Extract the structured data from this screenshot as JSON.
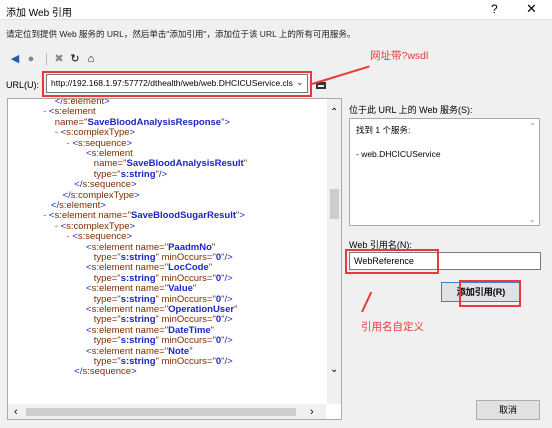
{
  "window": {
    "title": "添加 Web 引用",
    "help_label": "?",
    "close_label": "✕"
  },
  "instruction": "请定位到提供 Web 服务的 URL，然后单击\"添加引用\"，添加位于该 URL 上的所有可用服务。",
  "toolbar": {
    "back": "◀",
    "forward": "●",
    "stop": "✖",
    "refresh": "↻",
    "home": "⌂"
  },
  "url": {
    "label": "URL(U):",
    "value": "http://192.168.1.97:57772/dthealth/web/web.DHCICUService.cls",
    "dropdown": "⌄"
  },
  "annotations": {
    "url_note": "网址带?wsdl",
    "name_note": "引用名自定义"
  },
  "xml_lines": [
    {
      "indent": 12,
      "minus": "",
      "parts": [
        [
          "bracket",
          "</"
        ],
        [
          "tag",
          "s:element"
        ],
        [
          "bracket",
          ">"
        ]
      ]
    },
    {
      "indent": 9,
      "minus": "-",
      "parts": [
        [
          "bracket",
          "<"
        ],
        [
          "tag",
          "s:element"
        ]
      ]
    },
    {
      "indent": 12,
      "minus": "",
      "parts": [
        [
          "attr",
          "name=\""
        ],
        [
          "val",
          "SaveBloodAnalysisResponse"
        ],
        [
          "attr",
          "\""
        ],
        [
          "bracket",
          ">"
        ]
      ]
    },
    {
      "indent": 12,
      "minus": "-",
      "parts": [
        [
          "bracket",
          "<"
        ],
        [
          "tag",
          "s:complexType"
        ],
        [
          "bracket",
          ">"
        ]
      ]
    },
    {
      "indent": 15,
      "minus": "-",
      "parts": [
        [
          "bracket",
          "<"
        ],
        [
          "tag",
          "s:sequence"
        ],
        [
          "bracket",
          ">"
        ]
      ]
    },
    {
      "indent": 20,
      "minus": "",
      "parts": [
        [
          "bracket",
          "<"
        ],
        [
          "tag",
          "s:element"
        ]
      ]
    },
    {
      "indent": 22,
      "minus": "",
      "parts": [
        [
          "attr",
          "name=\""
        ],
        [
          "val",
          "SaveBloodAnalysisResult"
        ],
        [
          "attr",
          "\""
        ]
      ]
    },
    {
      "indent": 22,
      "minus": "",
      "parts": [
        [
          "attr",
          "type=\""
        ],
        [
          "val",
          "s:string"
        ],
        [
          "attr",
          "\""
        ],
        [
          "bracket",
          "/>"
        ]
      ]
    },
    {
      "indent": 17,
      "minus": "",
      "parts": [
        [
          "bracket",
          "</"
        ],
        [
          "tag",
          "s:sequence"
        ],
        [
          "bracket",
          ">"
        ]
      ]
    },
    {
      "indent": 14,
      "minus": "",
      "parts": [
        [
          "bracket",
          "</"
        ],
        [
          "tag",
          "s:complexType"
        ],
        [
          "bracket",
          ">"
        ]
      ]
    },
    {
      "indent": 11,
      "minus": "",
      "parts": [
        [
          "bracket",
          "</"
        ],
        [
          "tag",
          "s:element"
        ],
        [
          "bracket",
          ">"
        ]
      ]
    },
    {
      "indent": 9,
      "minus": "-",
      "parts": [
        [
          "bracket",
          "<"
        ],
        [
          "tag",
          "s:element "
        ],
        [
          "attr",
          "name=\""
        ],
        [
          "val",
          "SaveBloodSugarResult"
        ],
        [
          "attr",
          "\""
        ],
        [
          "bracket",
          ">"
        ]
      ]
    },
    {
      "indent": 12,
      "minus": "-",
      "parts": [
        [
          "bracket",
          "<"
        ],
        [
          "tag",
          "s:complexType"
        ],
        [
          "bracket",
          ">"
        ]
      ]
    },
    {
      "indent": 15,
      "minus": "-",
      "parts": [
        [
          "bracket",
          "<"
        ],
        [
          "tag",
          "s:sequence"
        ],
        [
          "bracket",
          ">"
        ]
      ]
    },
    {
      "indent": 20,
      "minus": "",
      "parts": [
        [
          "bracket",
          "<"
        ],
        [
          "tag",
          "s:element "
        ],
        [
          "attr",
          "name=\""
        ],
        [
          "val",
          "PaadmNo"
        ],
        [
          "attr",
          "\""
        ]
      ]
    },
    {
      "indent": 22,
      "minus": "",
      "parts": [
        [
          "attr",
          "type=\""
        ],
        [
          "val",
          "s:string"
        ],
        [
          "attr",
          "\" minOccurs=\""
        ],
        [
          "val",
          "0"
        ],
        [
          "attr",
          "\""
        ],
        [
          "bracket",
          "/>"
        ]
      ]
    },
    {
      "indent": 20,
      "minus": "",
      "parts": [
        [
          "bracket",
          "<"
        ],
        [
          "tag",
          "s:element "
        ],
        [
          "attr",
          "name=\""
        ],
        [
          "val",
          "LocCode"
        ],
        [
          "attr",
          "\""
        ]
      ]
    },
    {
      "indent": 22,
      "minus": "",
      "parts": [
        [
          "attr",
          "type=\""
        ],
        [
          "val",
          "s:string"
        ],
        [
          "attr",
          "\" minOccurs=\""
        ],
        [
          "val",
          "0"
        ],
        [
          "attr",
          "\""
        ],
        [
          "bracket",
          "/>"
        ]
      ]
    },
    {
      "indent": 20,
      "minus": "",
      "parts": [
        [
          "bracket",
          "<"
        ],
        [
          "tag",
          "s:element "
        ],
        [
          "attr",
          "name=\""
        ],
        [
          "val",
          "Value"
        ],
        [
          "attr",
          "\""
        ]
      ]
    },
    {
      "indent": 22,
      "minus": "",
      "parts": [
        [
          "attr",
          "type=\""
        ],
        [
          "val",
          "s:string"
        ],
        [
          "attr",
          "\" minOccurs=\""
        ],
        [
          "val",
          "0"
        ],
        [
          "attr",
          "\""
        ],
        [
          "bracket",
          "/>"
        ]
      ]
    },
    {
      "indent": 20,
      "minus": "",
      "parts": [
        [
          "bracket",
          "<"
        ],
        [
          "tag",
          "s:element "
        ],
        [
          "attr",
          "name=\""
        ],
        [
          "val",
          "OperationUser"
        ],
        [
          "attr",
          "\""
        ]
      ]
    },
    {
      "indent": 22,
      "minus": "",
      "parts": [
        [
          "attr",
          "type=\""
        ],
        [
          "val",
          "s:string"
        ],
        [
          "attr",
          "\" minOccurs=\""
        ],
        [
          "val",
          "0"
        ],
        [
          "attr",
          "\""
        ],
        [
          "bracket",
          "/>"
        ]
      ]
    },
    {
      "indent": 20,
      "minus": "",
      "parts": [
        [
          "bracket",
          "<"
        ],
        [
          "tag",
          "s:element "
        ],
        [
          "attr",
          "name=\""
        ],
        [
          "val",
          "DateTime"
        ],
        [
          "attr",
          "\""
        ]
      ]
    },
    {
      "indent": 22,
      "minus": "",
      "parts": [
        [
          "attr",
          "type=\""
        ],
        [
          "val",
          "s:string"
        ],
        [
          "attr",
          "\" minOccurs=\""
        ],
        [
          "val",
          "0"
        ],
        [
          "attr",
          "\""
        ],
        [
          "bracket",
          "/>"
        ]
      ]
    },
    {
      "indent": 20,
      "minus": "",
      "parts": [
        [
          "bracket",
          "<"
        ],
        [
          "tag",
          "s:element "
        ],
        [
          "attr",
          "name=\""
        ],
        [
          "val",
          "Note"
        ],
        [
          "attr",
          "\""
        ]
      ]
    },
    {
      "indent": 22,
      "minus": "",
      "parts": [
        [
          "attr",
          "type=\""
        ],
        [
          "val",
          "s:string"
        ],
        [
          "attr",
          "\" minOccurs=\""
        ],
        [
          "val",
          "0"
        ],
        [
          "attr",
          "\""
        ],
        [
          "bracket",
          "/>"
        ]
      ]
    },
    {
      "indent": 17,
      "minus": "",
      "parts": [
        [
          "bracket",
          "</"
        ],
        [
          "tag",
          "s:sequence"
        ],
        [
          "bracket",
          ">"
        ]
      ]
    }
  ],
  "services": {
    "label": "位于此 URL 上的 Web 服务(S):",
    "found": "找到 1 个服务:",
    "item": "- web.DHCICUService"
  },
  "web_reference": {
    "label": "Web 引用名(N):",
    "value": "WebReference"
  },
  "buttons": {
    "add": "添加引用(R)",
    "cancel": "取消"
  },
  "colors": {
    "annotation": "#e83a3a",
    "xml_tag": "#7d2c00",
    "xml_value": "#1c26c4"
  }
}
